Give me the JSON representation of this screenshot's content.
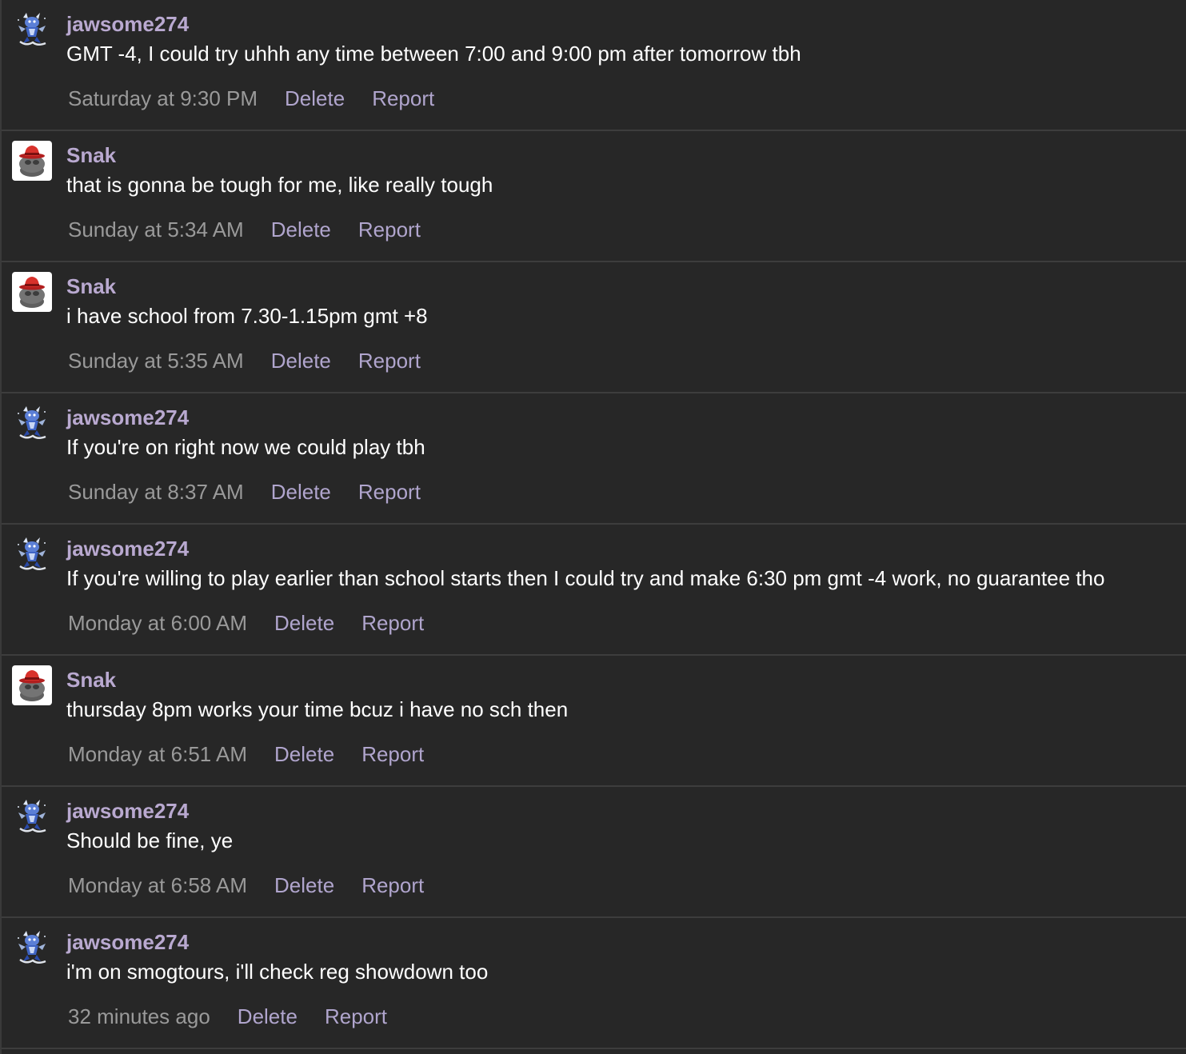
{
  "actions": {
    "delete_label": "Delete",
    "report_label": "Report"
  },
  "colors": {
    "background": "#272727",
    "username": "#b9a9d0",
    "action_link": "#b0a5cd",
    "timestamp": "#9a9a9a",
    "divider": "#3d3d3d"
  },
  "messages": [
    {
      "author": "jawsome274",
      "avatar_icon": "dragon-sprite-icon",
      "text": "GMT -4, I could try uhhh any time between 7:00 and 9:00 pm after tomorrow tbh",
      "timestamp": "Saturday at 9:30 PM"
    },
    {
      "author": "Snak",
      "avatar_icon": "red-hat-pot-icon",
      "text": "that is gonna be tough for me, like really tough",
      "timestamp": "Sunday at 5:34 AM"
    },
    {
      "author": "Snak",
      "avatar_icon": "red-hat-pot-icon",
      "text": "i have school from 7.30-1.15pm gmt +8",
      "timestamp": "Sunday at 5:35 AM"
    },
    {
      "author": "jawsome274",
      "avatar_icon": "dragon-sprite-icon",
      "text": "If you're on right now we could play tbh",
      "timestamp": "Sunday at 8:37 AM"
    },
    {
      "author": "jawsome274",
      "avatar_icon": "dragon-sprite-icon",
      "text": "If you're willing to play earlier than school starts then I could try and make 6:30 pm gmt -4 work, no guarantee tho",
      "timestamp": "Monday at 6:00 AM"
    },
    {
      "author": "Snak",
      "avatar_icon": "red-hat-pot-icon",
      "text": "thursday 8pm works your time bcuz i have no sch then",
      "timestamp": "Monday at 6:51 AM"
    },
    {
      "author": "jawsome274",
      "avatar_icon": "dragon-sprite-icon",
      "text": "Should be fine, ye",
      "timestamp": "Monday at 6:58 AM"
    },
    {
      "author": "jawsome274",
      "avatar_icon": "dragon-sprite-icon",
      "text": "i'm on smogtours, i'll check reg showdown too",
      "timestamp": "32 minutes ago"
    }
  ]
}
